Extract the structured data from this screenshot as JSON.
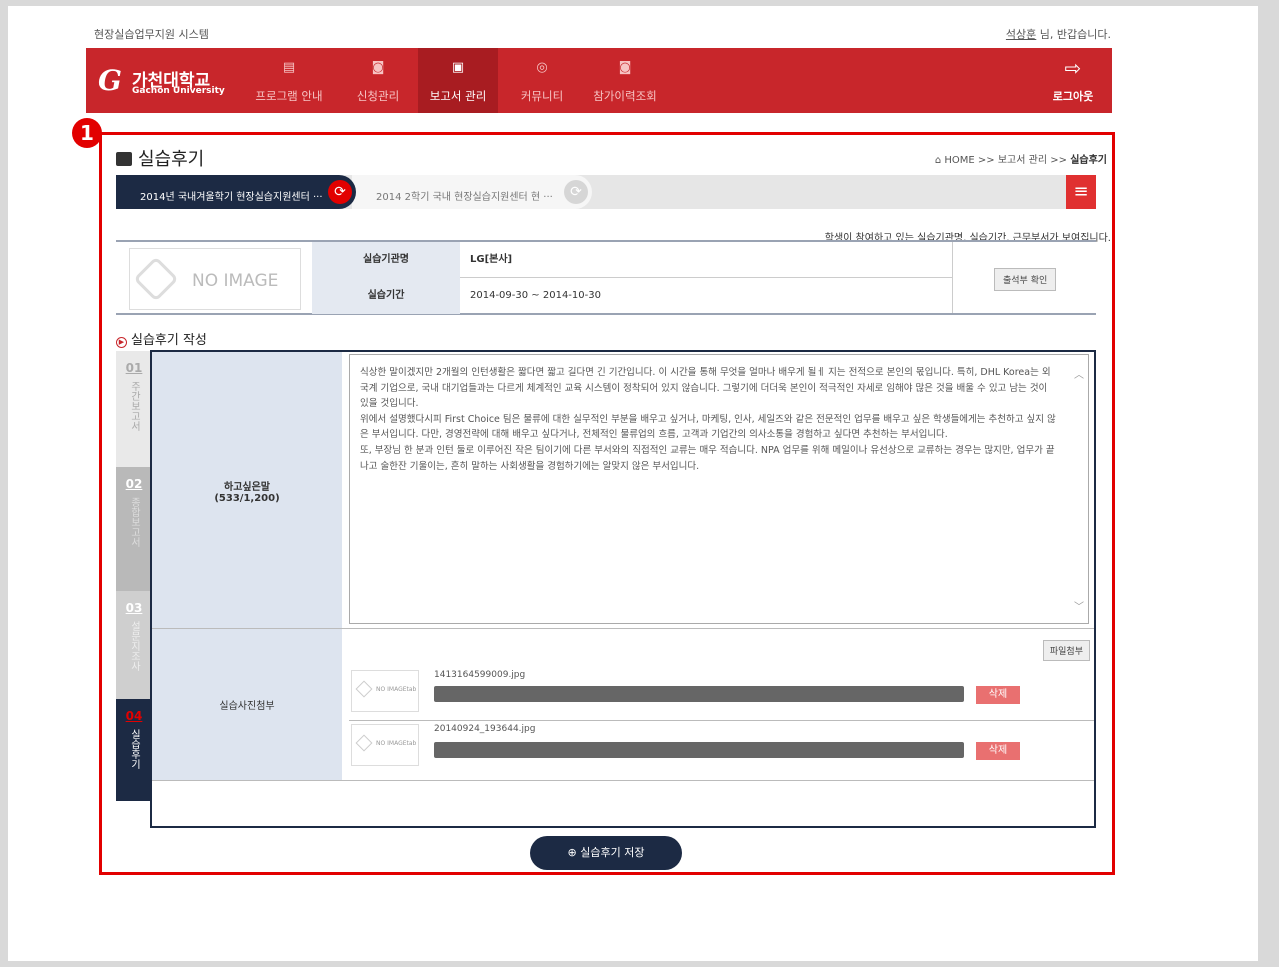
{
  "header": {
    "system_name": "현장실습업무지원 시스템",
    "user_name": "석상훈",
    "greeting_suffix": " 님, 반갑습니다."
  },
  "logo": {
    "kor": "가천대학교",
    "eng": "Gachon University"
  },
  "nav": {
    "items": [
      {
        "label": "프로그램 안내",
        "icon": "doc-icon"
      },
      {
        "label": "신청관리",
        "icon": "search-doc-icon"
      },
      {
        "label": "보고서 관리",
        "icon": "report-icon"
      },
      {
        "label": "커뮤니티",
        "icon": "broadcast-icon"
      },
      {
        "label": "참가이력조회",
        "icon": "search-doc-icon"
      }
    ],
    "logout": "로그아웃"
  },
  "badge_number": "1",
  "page_title": "실습후기",
  "breadcrumb": {
    "home": "HOME",
    "sep1": ">>",
    "mid": "보고서 관리",
    "sep2": ">>",
    "current": "실습후기"
  },
  "tabs": [
    {
      "label": "2014년 국내겨울학기 현장실습지원센터 ···"
    },
    {
      "label": "2014 2학기 국내 현장실습지원센터 현 ···"
    }
  ],
  "notice": "학생이 참여하고 있는 실습기관명, 실습기간, 근무부서가 보여집니다.",
  "info": {
    "no_image": "NO IMAGE",
    "org_label": "실습기관명",
    "org_value": "LG[본사]",
    "period_label": "실습기간",
    "period_value": "2014-09-30 ~ 2014-10-30",
    "attendance_button": "출석부 확인"
  },
  "section_title": "실습후기 작성",
  "side_tabs": [
    {
      "num": "01",
      "label": "주간보고서"
    },
    {
      "num": "02",
      "label": "종합보고서"
    },
    {
      "num": "03",
      "label": "설문지조사"
    },
    {
      "num": "04",
      "label": "실습후기"
    }
  ],
  "form": {
    "comment_label": "하고싶은말",
    "comment_count": "(533/1,200)",
    "comment_text": "식상한 말이겠지만 2개월의 인턴생활은 짧다면 짧고 길다면 긴 기간입니다. 이 시간을 통해 무엇을 얼마나 배우게 될ㅔ 지는 전적으로 본인의 몫입니다. 특히, DHL Korea는 외국계 기업으로, 국내 대기업들과는 다르게 체계적인 교육 시스템이 정착되어 있지 않습니다. 그렇기에 더더욱 본인이 적극적인 자세로 임해야 많은 것을 배울 수 있고 남는 것이 있을 것입니다.\n 위에서 설명했다시피 First Choice 팀은 물류에 대한 실무적인 부분을 배우고 싶거나, 마케팅, 인사, 세일즈와 같은 전문적인 업무를 배우고 싶은 학생들에게는 추천하고 싶지 않은 부서입니다. 다만, 경영전략에 대해 배우고 싶다거나, 전체적인 물류업의 흐름, 고객과 기업간의 의사소통을 경험하고 싶다면 추천하는 부서입니다.\n 또, 부장님 한 분과 인턴 둘로 이루어진 작은 팀이기에 다른 부서와의 직접적인 교류는 매우 적습니다. NPA 업무를 위해 메일이나 유선상으로 교류하는 경우는 많지만, 업무가 끝나고 술한잔 기울이는, 흔히 말하는 사회생활을 경험하기에는 알맞지 않은 부서입니다.",
    "photo_label": "실습사진첨부",
    "attach_button": "파일첨부",
    "photos": [
      {
        "filename": "1413164599009.jpg",
        "thumb": "NO IMAGEtab",
        "delete": "삭제"
      },
      {
        "filename": "20140924_193644.jpg",
        "thumb": "NO IMAGEtab",
        "delete": "삭제"
      }
    ]
  },
  "save_button": "실습후기 저장",
  "colors": {
    "brand_red": "#c8262b",
    "navy": "#1c2a44",
    "highlight_red": "#e20000"
  }
}
